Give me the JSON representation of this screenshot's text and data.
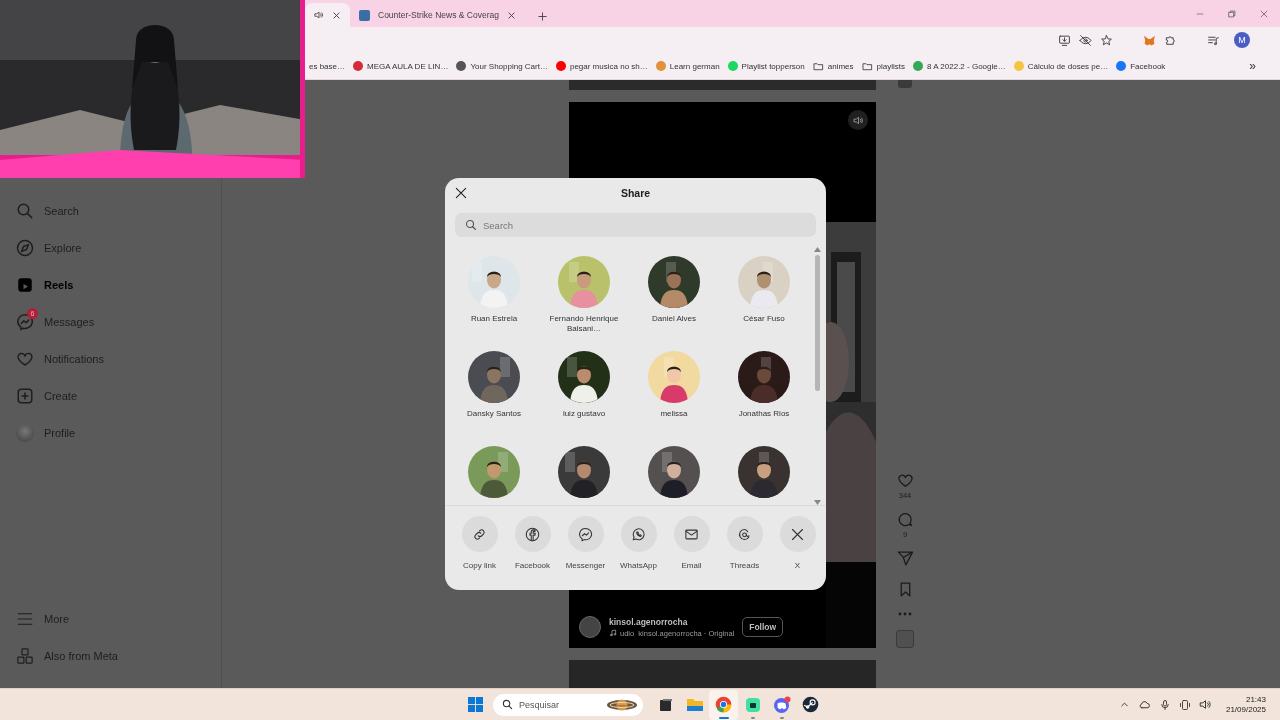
{
  "webcam_overlay": {
    "kind": "picture"
  },
  "browser": {
    "tabs": [
      {
        "audio": true,
        "selected": true
      },
      {
        "title": "Counter-Strike News & Coverag",
        "audio": false,
        "selected": false
      }
    ],
    "profile_initial": "M",
    "bookmarks": [
      {
        "label": "es base…",
        "kind": "text"
      },
      {
        "label": "MEGA AULA DE LIN…",
        "kind": "site",
        "color": "#d62b3a"
      },
      {
        "label": "Your Shopping Cart…",
        "kind": "site",
        "color": "#555555"
      },
      {
        "label": "pegar musica no sh…",
        "kind": "site",
        "color": "#ff0000"
      },
      {
        "label": "Learn german",
        "kind": "site",
        "color": "#e0913a"
      },
      {
        "label": "Playlist topperson",
        "kind": "site",
        "color": "#1ed760"
      },
      {
        "label": "animes",
        "kind": "folder"
      },
      {
        "label": "playlists",
        "kind": "folder"
      },
      {
        "label": "8 A 2022.2 - Google…",
        "kind": "site",
        "color": "#34a853"
      },
      {
        "label": "Cálculo de doses pe…",
        "kind": "site",
        "color": "#f4c542"
      },
      {
        "label": "Facebook",
        "kind": "site",
        "color": "#1877f2"
      }
    ],
    "bookmarks_overflow": "»"
  },
  "sidebar": {
    "items": [
      {
        "label": "Search",
        "selected": false
      },
      {
        "label": "Explore",
        "selected": false
      },
      {
        "label": "Reels",
        "selected": true
      },
      {
        "label": "Messages",
        "selected": false,
        "badge": "6"
      },
      {
        "label": "Notifications",
        "selected": false
      },
      {
        "label": "Create",
        "selected": false
      },
      {
        "label": "Profile",
        "selected": false
      }
    ],
    "footer": [
      {
        "label": "More"
      },
      {
        "label": "Also from Meta"
      }
    ]
  },
  "reel": {
    "kind": "picture",
    "author": "kinsol.agenorrocha",
    "audio": "udio  kinsol.agenorrocha · Original",
    "follow": "Follow",
    "likes": "344",
    "comments": "9"
  },
  "share_dialog": {
    "title": "Share",
    "search": {
      "placeholder": "Search"
    },
    "contacts": [
      {
        "kind": "picture",
        "name": "Ruan Estrela"
      },
      {
        "kind": "picture",
        "name": "Fernando Henrique Balsani…"
      },
      {
        "kind": "picture",
        "name": "Daniel Alves"
      },
      {
        "kind": "picture",
        "name": "César Fuso"
      },
      {
        "kind": "picture",
        "name": "Dansky Santos"
      },
      {
        "kind": "picture",
        "name": "luiz gustavo"
      },
      {
        "kind": "picture",
        "name": "melissa"
      },
      {
        "kind": "picture",
        "name": "Jonathas Rios"
      },
      {
        "kind": "picture"
      },
      {
        "kind": "picture"
      },
      {
        "kind": "picture"
      },
      {
        "kind": "picture"
      }
    ],
    "options": [
      {
        "label": "Copy link"
      },
      {
        "label": "Facebook"
      },
      {
        "label": "Messenger"
      },
      {
        "label": "WhatsApp"
      },
      {
        "label": "Email"
      },
      {
        "label": "Threads"
      },
      {
        "label": "X"
      }
    ]
  },
  "taskbar": {
    "search": {
      "placeholder": "Pesquisar"
    },
    "apps": [
      {
        "open": false,
        "selected": false
      },
      {
        "open": false,
        "selected": false
      },
      {
        "open": true,
        "selected": true
      },
      {
        "open": true,
        "selected": false
      },
      {
        "open": true,
        "selected": false
      },
      {
        "open": false,
        "selected": false
      }
    ],
    "time": "21:43",
    "date": "21/09/2025"
  }
}
